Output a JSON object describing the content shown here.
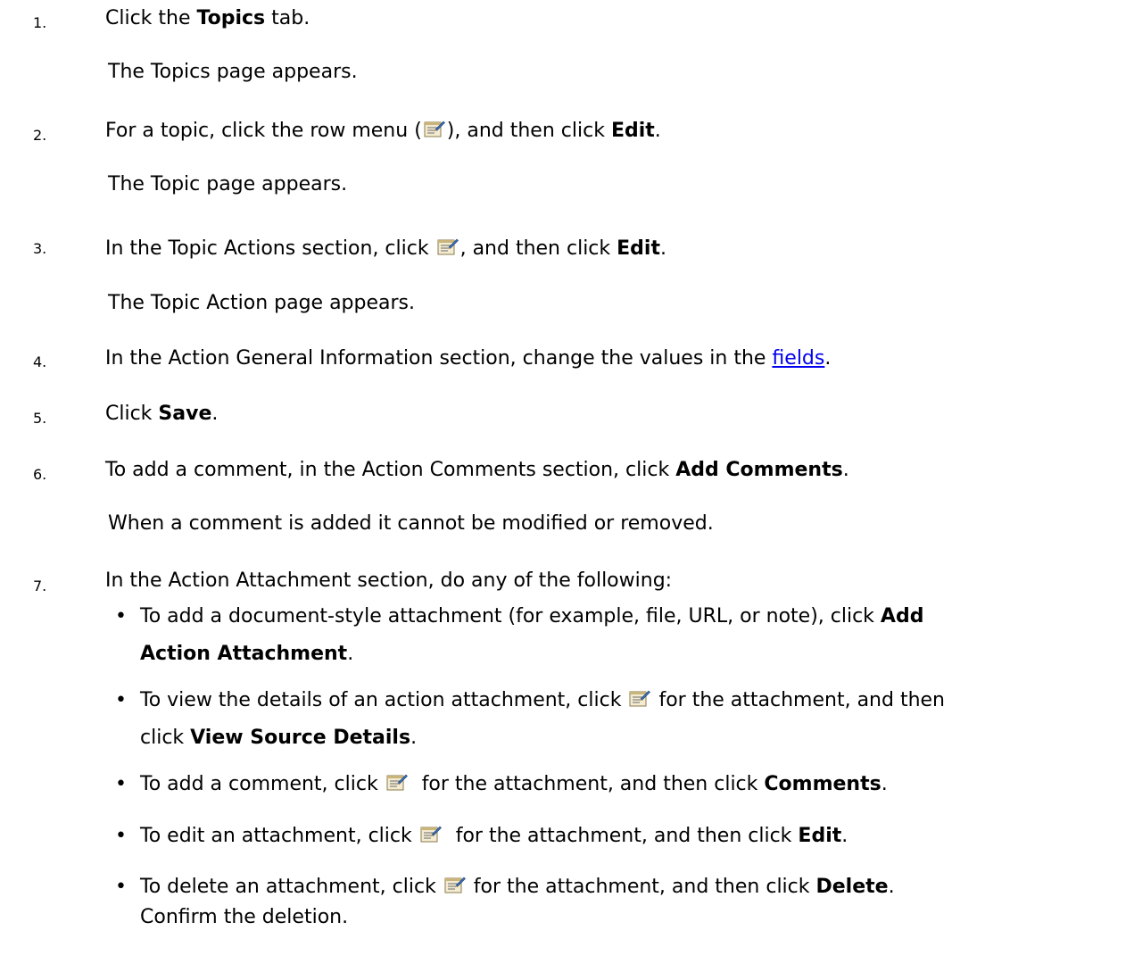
{
  "steps": [
    {
      "number": "1.",
      "pre": "Click the ",
      "bold": "Topics",
      "post": " tab.",
      "result": "The Topics page appears."
    },
    {
      "number": "2.",
      "pre": "For a topic, click the row menu (",
      "mid": "), and then click ",
      "bold": "Edit",
      "post": ".",
      "result": "The Topic page appears."
    },
    {
      "number": "3.",
      "pre": "In the Topic Actions section, click ",
      "mid": ", and then click ",
      "bold": "Edit",
      "post": ".",
      "result": "The Topic Action page appears."
    },
    {
      "number": "4.",
      "pre": "In the Action General Information section, change the values in the ",
      "link": "fields",
      "post": "."
    },
    {
      "number": "5.",
      "pre": "Click ",
      "bold": "Save",
      "post": "."
    },
    {
      "number": "6.",
      "pre": "To add a comment, in the Action Comments section, click ",
      "bold": "Add Comments",
      "post": ".",
      "result": "When a comment is added it cannot be modified or removed."
    },
    {
      "number": "7.",
      "pre": "In the Action Attachment section, do any of the following:",
      "bullets": [
        {
          "line1_pre": "To add a document-style attachment (for example, file, URL, or note), click ",
          "line1_bold": "Add",
          "line2_bold": "Action Attachment",
          "line2_post": "."
        },
        {
          "line1_pre": "To view the details of an action attachment, click ",
          "line1_post": " for the attachment, and then",
          "line2_pre": "click ",
          "line2_bold": "View Source Details",
          "line2_post": "."
        },
        {
          "line1_pre": "To add a comment, click ",
          "line1_mid": "  for the attachment, and then click ",
          "line1_bold": "Comments",
          "line1_post": "."
        },
        {
          "line1_pre": "To edit an attachment, click ",
          "line1_mid": "  for the attachment, and then click ",
          "line1_bold": "Edit",
          "line1_post": "."
        },
        {
          "line1_pre": "To delete an attachment, click ",
          "line1_mid": " for the attachment, and then click ",
          "line1_bold": "Delete",
          "line1_post": ".",
          "line2_pre": "Confirm the deletion."
        }
      ]
    }
  ],
  "icons": {
    "row_menu_icon": "row-menu-icon"
  }
}
